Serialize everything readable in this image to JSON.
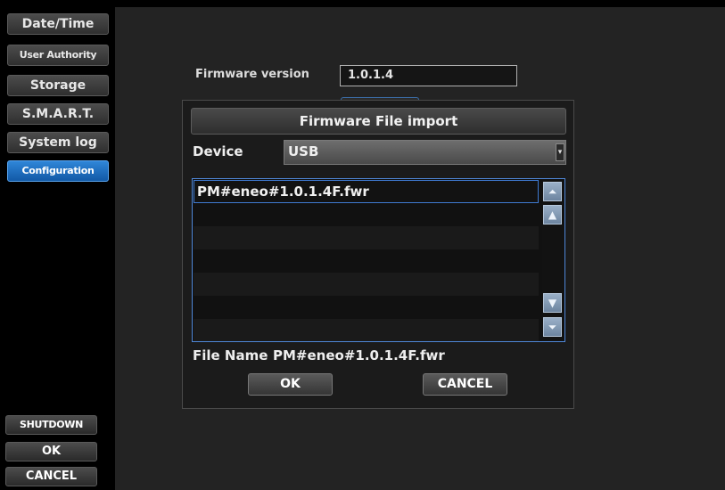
{
  "sidebar": {
    "items": [
      {
        "label": "Date/Time"
      },
      {
        "label": "User Authority"
      },
      {
        "label": "Storage"
      },
      {
        "label": "S.M.A.R.T."
      },
      {
        "label": "System log"
      },
      {
        "label": "Configuration",
        "active": true
      }
    ],
    "shutdown_label": "SHUTDOWN",
    "ok_label": "OK",
    "cancel_label": "CANCEL"
  },
  "main": {
    "firmware_version_label": "Firmware version",
    "firmware_version_value": "1.0.1.4"
  },
  "dialog": {
    "title": "Firmware File import",
    "device_label": "Device",
    "device_value": "USB",
    "files": [
      "PM#eneo#1.0.1.4F.fwr"
    ],
    "file_name_label": "File Name",
    "file_name_value": "PM#eneo#1.0.1.4F.fwr",
    "ok_label": "OK",
    "cancel_label": "CANCEL"
  },
  "colors": {
    "accent": "#1f74c8",
    "background": "#000000",
    "panel": "#232323"
  }
}
